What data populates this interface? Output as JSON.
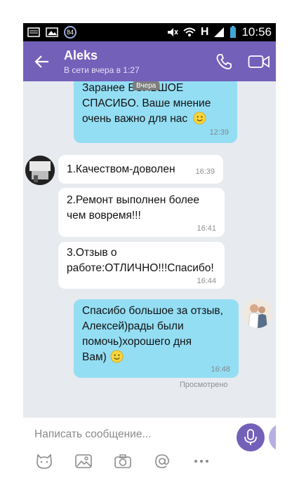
{
  "status_bar": {
    "time": "10:56",
    "badge": "84",
    "network": "H"
  },
  "header": {
    "contact_name": "Aleks",
    "last_seen": "В сети вчера в 1:27"
  },
  "chat": {
    "date_chip": "Вчера",
    "messages": [
      {
        "direction": "out",
        "line1": "Заранее БОЛЬШОЕ",
        "line2": "СПАСИБО. Ваше мнение",
        "line3": "очень важно для нас",
        "time": "12:39"
      },
      {
        "direction": "in",
        "text": "1.Качеством-доволен",
        "time": "16:39"
      },
      {
        "direction": "in",
        "line1": "2.Ремонт выполнен более",
        "line2": "чем вовремя!!!",
        "time": "16:41"
      },
      {
        "direction": "in",
        "line1": "3.Отзыв о",
        "line2": "работе:ОТЛИЧНО!!!Спасибо!",
        "time": "16:44"
      },
      {
        "direction": "out",
        "line1": "Спасибо большое за отзыв,",
        "line2": "Алексей)рады были",
        "line3": "помочь)хорошего дня",
        "line4": "Вам)",
        "time": "16:48"
      }
    ],
    "seen_label": "Просмотрено"
  },
  "composer": {
    "placeholder": "Написать сообщение...",
    "tools": [
      "sticker-icon",
      "gallery-icon",
      "camera-icon",
      "mention-icon",
      "more-icon"
    ]
  },
  "colors": {
    "appbar": "#7360b9",
    "outgoing": "#94def4",
    "incoming": "#ffffff",
    "chat_bg": "#e7eaee"
  }
}
